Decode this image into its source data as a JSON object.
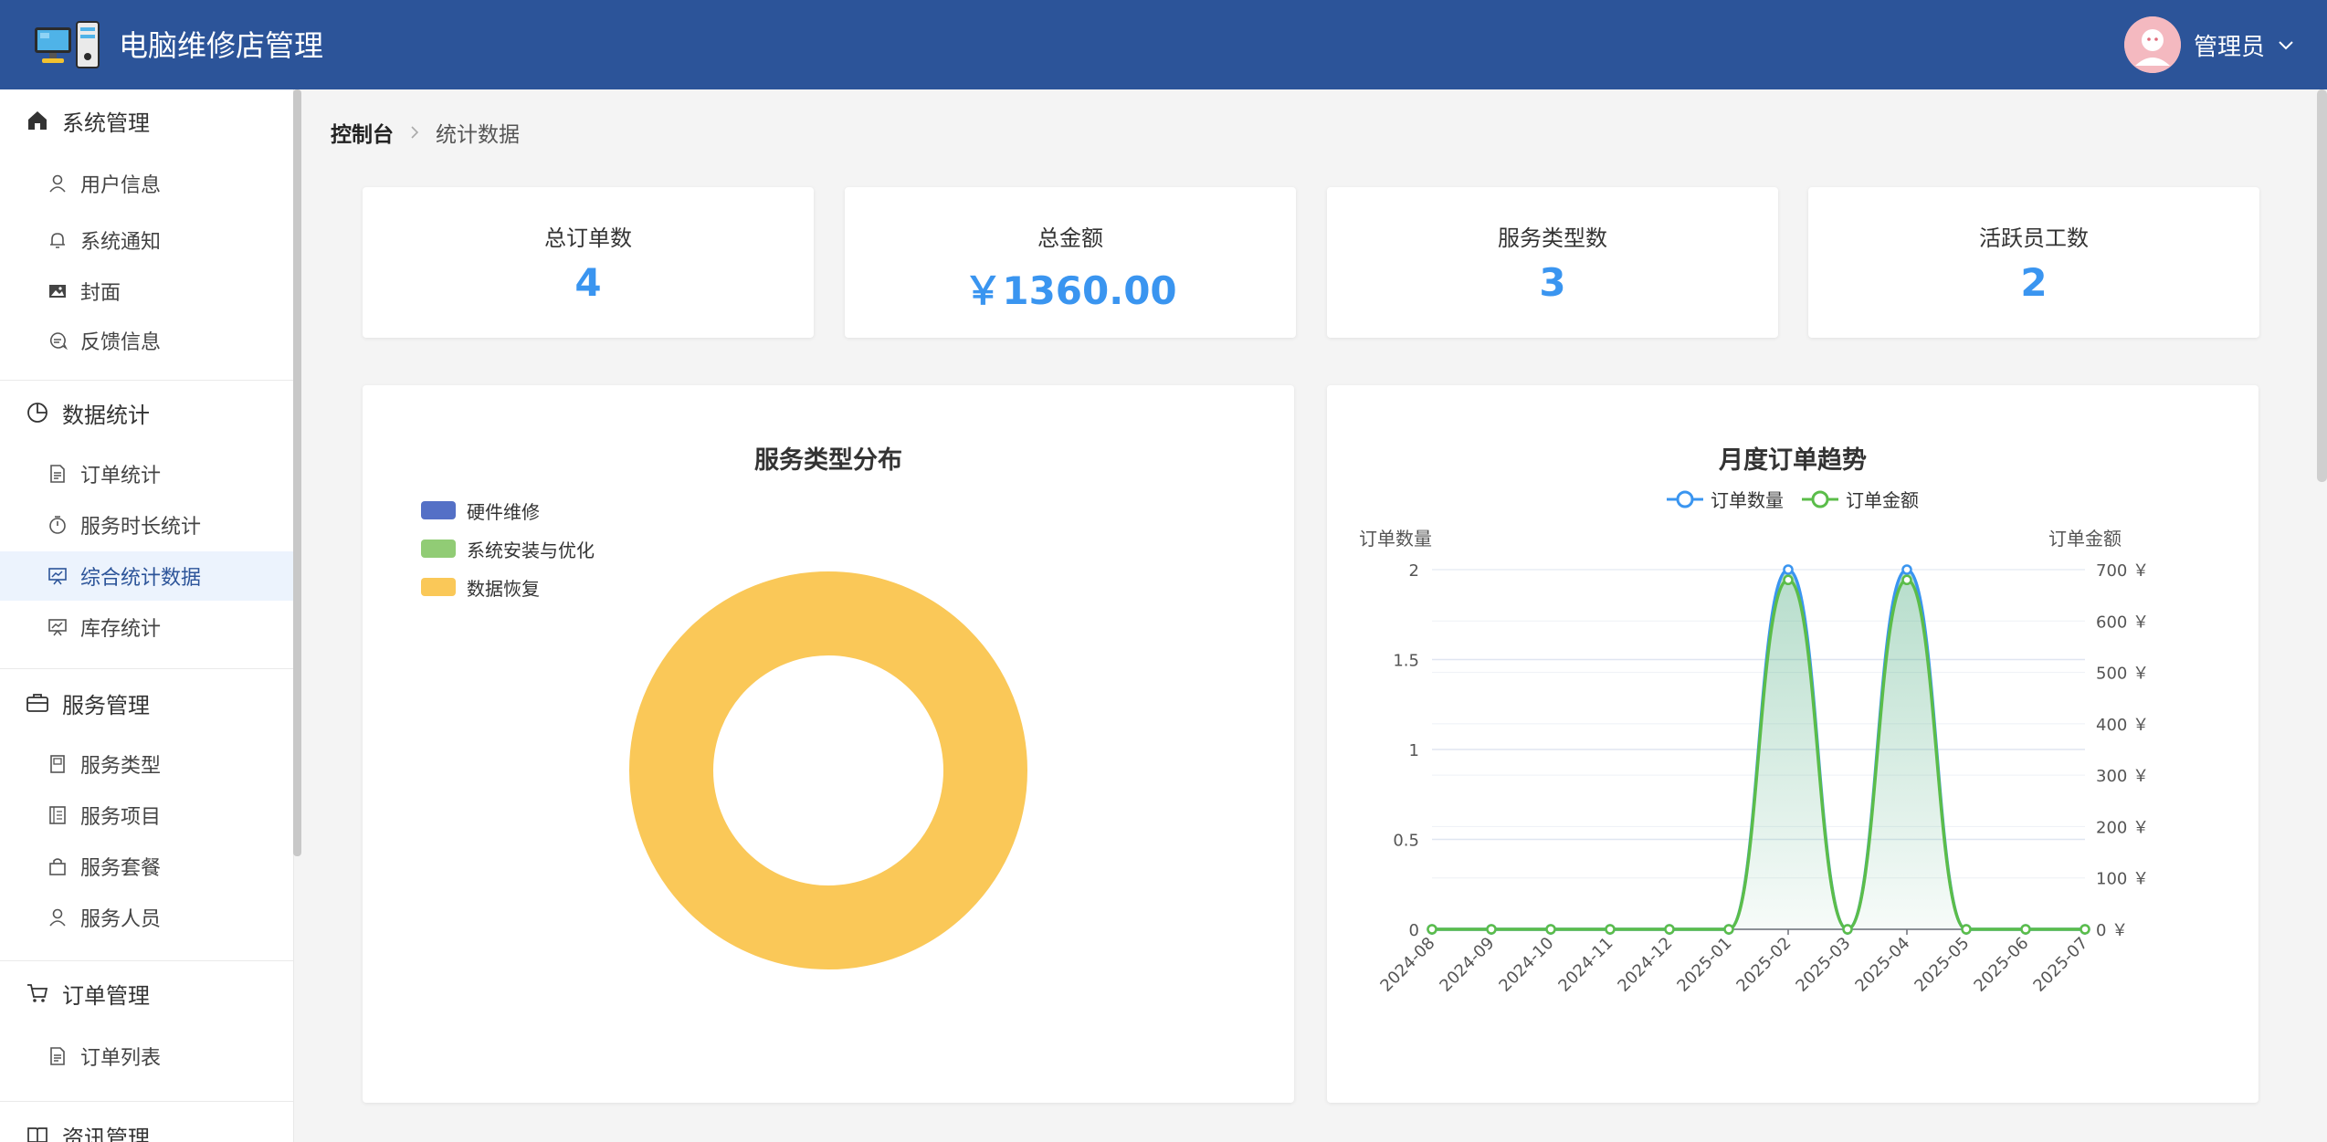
{
  "header": {
    "title": "电脑维修店管理",
    "user_name": "管理员",
    "brand_color": "#2c5499"
  },
  "sidebar": {
    "groups": [
      {
        "title": "系统管理",
        "icon": "home-icon",
        "items": [
          {
            "label": "用户信息",
            "icon": "user-icon"
          },
          {
            "label": "系统通知",
            "icon": "bell-icon"
          },
          {
            "label": "封面",
            "icon": "image-icon"
          },
          {
            "label": "反馈信息",
            "icon": "chat-icon"
          }
        ]
      },
      {
        "title": "数据统计",
        "icon": "pie-icon",
        "items": [
          {
            "label": "订单统计",
            "icon": "document-icon"
          },
          {
            "label": "服务时长统计",
            "icon": "stopwatch-icon"
          },
          {
            "label": "综合统计数据",
            "icon": "presentation-icon",
            "active": true
          },
          {
            "label": "库存统计",
            "icon": "presentation-icon"
          }
        ]
      },
      {
        "title": "服务管理",
        "icon": "briefcase-icon",
        "items": [
          {
            "label": "服务类型",
            "icon": "notebook-icon"
          },
          {
            "label": "服务项目",
            "icon": "list-icon"
          },
          {
            "label": "服务套餐",
            "icon": "bag-icon"
          },
          {
            "label": "服务人员",
            "icon": "user-icon"
          }
        ]
      },
      {
        "title": "订单管理",
        "icon": "cart-icon",
        "items": [
          {
            "label": "订单列表",
            "icon": "document-icon"
          }
        ]
      },
      {
        "title": "资讯管理",
        "icon": "book-icon",
        "items": []
      }
    ]
  },
  "breadcrumb": {
    "home": "控制台",
    "current": "统计数据"
  },
  "stats": [
    {
      "label": "总订单数",
      "value": "4"
    },
    {
      "label": "总金额",
      "value": "￥1360.00"
    },
    {
      "label": "服务类型数",
      "value": "3"
    },
    {
      "label": "活跃员工数",
      "value": "2"
    }
  ],
  "chart_data": [
    {
      "type": "pie",
      "title": "服务类型分布",
      "legend_position": "top-left",
      "categories": [
        "硬件维修",
        "系统安装与优化",
        "数据恢复"
      ],
      "values": [
        0,
        0,
        1
      ],
      "colors": [
        "#5470c6",
        "#91cc75",
        "#fac858"
      ]
    },
    {
      "type": "area",
      "title": "月度订单趋势",
      "legend_position": "top-center",
      "x": [
        "2024-08",
        "2024-09",
        "2024-10",
        "2024-11",
        "2024-12",
        "2025-01",
        "2025-02",
        "2025-03",
        "2025-04",
        "2025-05",
        "2025-06",
        "2025-07"
      ],
      "series": [
        {
          "name": "订单数量",
          "axis": "left",
          "values": [
            0,
            0,
            0,
            0,
            0,
            0,
            2,
            0,
            2,
            0,
            0,
            0
          ],
          "color": "#3a95f0"
        },
        {
          "name": "订单金额",
          "axis": "right",
          "values": [
            0,
            0,
            0,
            0,
            0,
            0,
            680,
            0,
            680,
            0,
            0,
            0
          ],
          "color": "#5bbd4a"
        }
      ],
      "ylabel_left": "订单数量",
      "ylabel_right": "订单金额",
      "ylim_left": [
        0,
        2
      ],
      "ylim_right": [
        0,
        700
      ],
      "left_ticks": [
        "0",
        "0.5",
        "1",
        "1.5",
        "2"
      ],
      "right_ticks": [
        "0 ￥",
        "100 ￥",
        "200 ￥",
        "300 ￥",
        "400 ￥",
        "500 ￥",
        "600 ￥",
        "700 ￥"
      ],
      "grid": true
    }
  ]
}
